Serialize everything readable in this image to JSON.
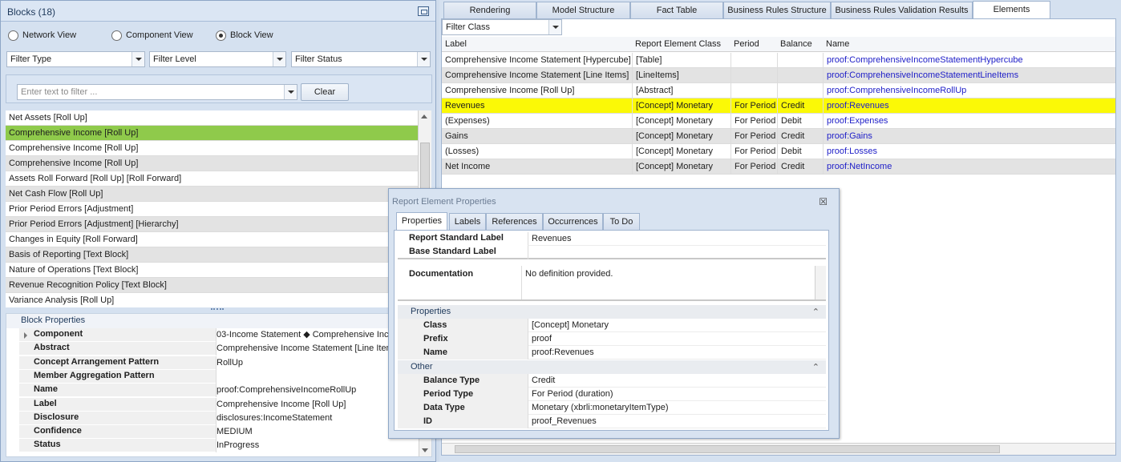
{
  "left": {
    "title": "Blocks (18)",
    "views": [
      {
        "label": "Network View",
        "selected": false
      },
      {
        "label": "Component View",
        "selected": false
      },
      {
        "label": "Block View",
        "selected": true
      }
    ],
    "filters": {
      "type": "Filter Type",
      "level": "Filter Level",
      "status": "Filter Status"
    },
    "search": {
      "placeholder": "Enter text to filter ...",
      "clear_label": "Clear"
    },
    "blocks": [
      "Net Assets [Roll Up]",
      "Comprehensive Income [Roll Up]",
      "Comprehensive Income [Roll Up]",
      "Comprehensive Income [Roll Up]",
      "Assets Roll Forward [Roll Up] [Roll Forward]",
      "Net Cash Flow [Roll Up]",
      "Prior Period Errors [Adjustment]",
      "Prior Period Errors [Adjustment] [Hierarchy]",
      "Changes in Equity [Roll Forward]",
      "Basis of Reporting [Text Block]",
      "Nature of Operations [Text Block]",
      "Revenue Recognition Policy [Text Block]",
      "Variance Analysis  [Roll Up]"
    ],
    "selected_block_index": 1,
    "block_properties": {
      "title": "Block Properties",
      "rows": [
        {
          "key": "Component",
          "value": "03-Income Statement ◆  Comprehensive Inco"
        },
        {
          "key": "Abstract",
          "value": "Comprehensive Income Statement [Line Items"
        },
        {
          "key": "Concept Arrangement Pattern",
          "value": "RollUp"
        },
        {
          "key": "Member Aggregation Pattern",
          "value": ""
        },
        {
          "key": "Name",
          "value": "proof:ComprehensiveIncomeRollUp"
        },
        {
          "key": "Label",
          "value": "Comprehensive Income [Roll Up]"
        },
        {
          "key": "Disclosure",
          "value": "disclosures:IncomeStatement"
        },
        {
          "key": "Confidence",
          "value": "MEDIUM"
        },
        {
          "key": "Status",
          "value": "InProgress"
        }
      ]
    }
  },
  "right": {
    "tabs": [
      "Rendering",
      "Model Structure",
      "Fact Table",
      "Business Rules Structure",
      "Business Rules Validation Results",
      "Elements"
    ],
    "active_tab": "Elements",
    "filter_class": "Filter Class",
    "columns": [
      "Label",
      "Report Element Class",
      "Period",
      "Balance",
      "Name"
    ],
    "rows": [
      [
        "Comprehensive Income Statement [Hypercube]",
        "[Table]",
        "",
        "",
        "proof:ComprehensiveIncomeStatementHypercube"
      ],
      [
        "Comprehensive Income Statement [Line Items]",
        "[LineItems]",
        "",
        "",
        "proof:ComprehensiveIncomeStatementLineItems"
      ],
      [
        "Comprehensive Income [Roll Up]",
        "[Abstract]",
        "",
        "",
        "proof:ComprehensiveIncomeRollUp"
      ],
      [
        "Revenues",
        "[Concept] Monetary",
        "For Period",
        "Credit",
        "proof:Revenues"
      ],
      [
        "(Expenses)",
        "[Concept] Monetary",
        "For Period",
        "Debit",
        "proof:Expenses"
      ],
      [
        "Gains",
        "[Concept] Monetary",
        "For Period",
        "Credit",
        "proof:Gains"
      ],
      [
        "(Losses)",
        "[Concept] Monetary",
        "For Period",
        "Debit",
        "proof:Losses"
      ],
      [
        "Net Income",
        "[Concept] Monetary",
        "For Period",
        "Credit",
        "proof:NetIncome"
      ]
    ],
    "highlight_row": 3
  },
  "dialog": {
    "title": "Report Element Properties",
    "close": "☒",
    "tabs": [
      "Properties",
      "Labels",
      "References",
      "Occurrences",
      "To Do"
    ],
    "active_tab": "Properties",
    "standard_label_key": "Report Standard Label",
    "standard_label_value": "Revenues",
    "base_label_key": "Base Standard Label",
    "base_label_value": "",
    "documentation_key": "Documentation",
    "documentation_value": "No definition provided.",
    "properties_section": "Properties",
    "properties": [
      {
        "key": "Class",
        "value": "[Concept] Monetary"
      },
      {
        "key": "Prefix",
        "value": "proof"
      },
      {
        "key": "Name",
        "value": "proof:Revenues"
      }
    ],
    "other_section": "Other",
    "other": [
      {
        "key": "Balance Type",
        "value": "Credit"
      },
      {
        "key": "Period Type",
        "value": "For Period (duration)"
      },
      {
        "key": "Data Type",
        "value": "Monetary (xbrli:monetaryItemType)"
      },
      {
        "key": "ID",
        "value": "proof_Revenues"
      }
    ]
  },
  "colors": {
    "selected_block": "#8fca4b",
    "highlight_row": "#fbf906",
    "link": "#2020c8",
    "panel": "#d5e1f0"
  }
}
